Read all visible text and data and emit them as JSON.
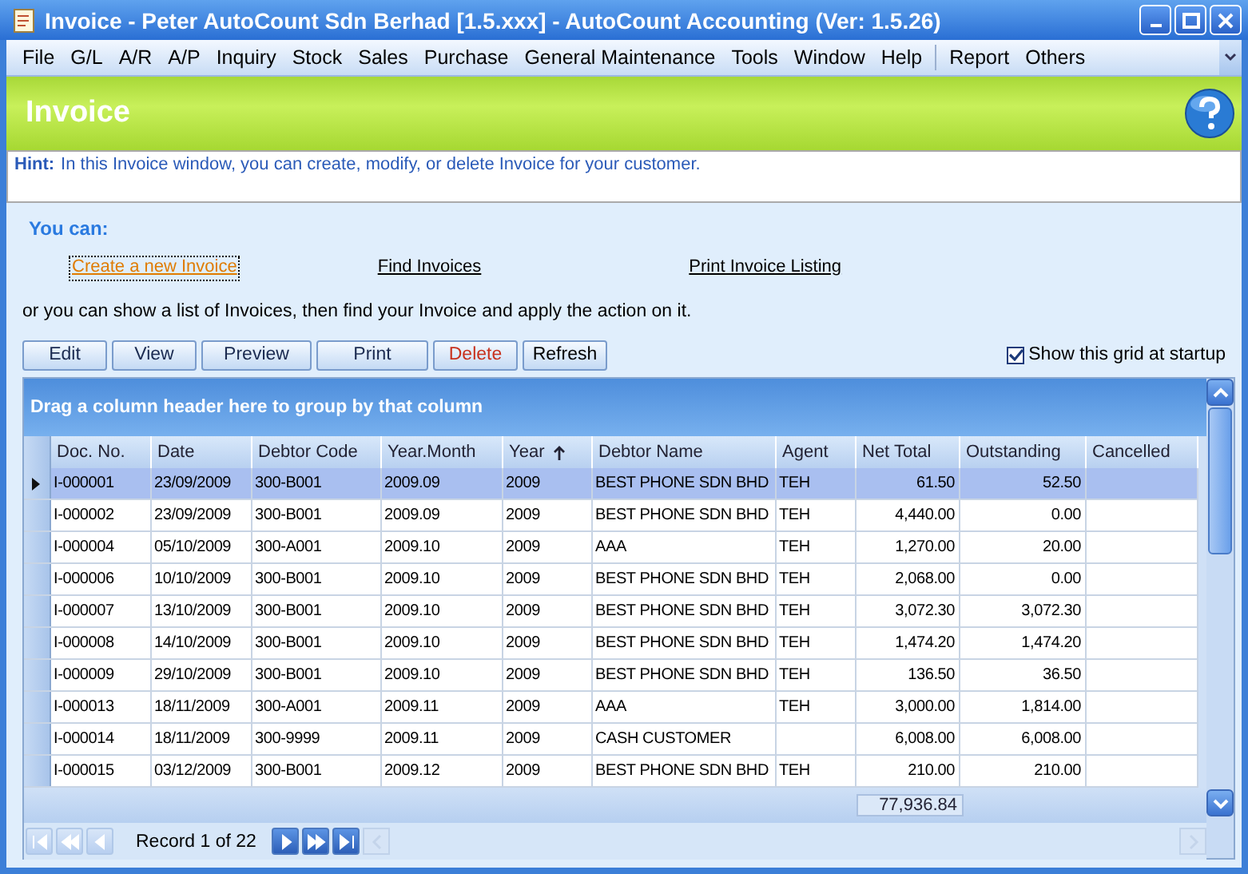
{
  "window": {
    "title": "Invoice - Peter AutoCount Sdn Berhad [1.5.xxx] - AutoCount Accounting (Ver: 1.5.26)"
  },
  "menu": {
    "items": [
      "File",
      "G/L",
      "A/R",
      "A/P",
      "Inquiry",
      "Stock",
      "Sales",
      "Purchase",
      "General Maintenance",
      "Tools",
      "Window",
      "Help"
    ],
    "extra_items": [
      "Report",
      "Others"
    ]
  },
  "header": {
    "title": "Invoice"
  },
  "hint": {
    "label": "Hint:",
    "text": "In this Invoice window, you can create, modify, or delete Invoice for your customer."
  },
  "you_can": "You can:",
  "links": [
    {
      "label": "Create a new Invoice",
      "focused": true
    },
    {
      "label": "Find Invoices",
      "focused": false
    },
    {
      "label": "Print Invoice Listing",
      "focused": false
    }
  ],
  "instruction": "or you can show a list of Invoices, then find your Invoice and apply the action on it.",
  "buttons": [
    {
      "label": "Edit",
      "kind": "normal"
    },
    {
      "label": "View",
      "kind": "normal"
    },
    {
      "label": "Preview",
      "kind": "normal"
    },
    {
      "label": "Print",
      "kind": "normal"
    },
    {
      "label": "Delete",
      "kind": "delete"
    },
    {
      "label": "Refresh",
      "kind": "normal"
    }
  ],
  "show_grid": {
    "label": "Show this grid at startup",
    "checked": true
  },
  "grid": {
    "group_panel": "Drag a column header here to group by that column",
    "columns": [
      {
        "label": "Doc. No.",
        "sorted_ascending": false
      },
      {
        "label": "Date",
        "sorted_ascending": false
      },
      {
        "label": "Debtor Code",
        "sorted_ascending": false
      },
      {
        "label": "Year.Month",
        "sorted_ascending": false
      },
      {
        "label": "Year",
        "sorted_ascending": true
      },
      {
        "label": "Debtor Name",
        "sorted_ascending": false
      },
      {
        "label": "Agent",
        "sorted_ascending": false
      },
      {
        "label": "Net Total",
        "sorted_ascending": false
      },
      {
        "label": "Outstanding",
        "sorted_ascending": false
      },
      {
        "label": "Cancelled",
        "sorted_ascending": false
      }
    ],
    "rows": [
      {
        "selected": true,
        "cells": [
          "I-000001",
          "23/09/2009",
          "300-B001",
          "2009.09",
          "2009",
          "BEST PHONE SDN BHD",
          "TEH",
          "61.50",
          "52.50",
          ""
        ]
      },
      {
        "selected": false,
        "cells": [
          "I-000002",
          "23/09/2009",
          "300-B001",
          "2009.09",
          "2009",
          "BEST PHONE SDN BHD",
          "TEH",
          "4,440.00",
          "0.00",
          ""
        ]
      },
      {
        "selected": false,
        "cells": [
          "I-000004",
          "05/10/2009",
          "300-A001",
          "2009.10",
          "2009",
          "AAA",
          "TEH",
          "1,270.00",
          "20.00",
          ""
        ]
      },
      {
        "selected": false,
        "cells": [
          "I-000006",
          "10/10/2009",
          "300-B001",
          "2009.10",
          "2009",
          "BEST PHONE SDN BHD",
          "TEH",
          "2,068.00",
          "0.00",
          ""
        ]
      },
      {
        "selected": false,
        "cells": [
          "I-000007",
          "13/10/2009",
          "300-B001",
          "2009.10",
          "2009",
          "BEST PHONE SDN BHD",
          "TEH",
          "3,072.30",
          "3,072.30",
          ""
        ]
      },
      {
        "selected": false,
        "cells": [
          "I-000008",
          "14/10/2009",
          "300-B001",
          "2009.10",
          "2009",
          "BEST PHONE SDN BHD",
          "TEH",
          "1,474.20",
          "1,474.20",
          ""
        ]
      },
      {
        "selected": false,
        "cells": [
          "I-000009",
          "29/10/2009",
          "300-B001",
          "2009.10",
          "2009",
          "BEST PHONE SDN BHD",
          "TEH",
          "136.50",
          "36.50",
          ""
        ]
      },
      {
        "selected": false,
        "cells": [
          "I-000013",
          "18/11/2009",
          "300-A001",
          "2009.11",
          "2009",
          "AAA",
          "TEH",
          "3,000.00",
          "1,814.00",
          ""
        ]
      },
      {
        "selected": false,
        "cells": [
          "I-000014",
          "18/11/2009",
          "300-9999",
          "2009.11",
          "2009",
          "CASH CUSTOMER",
          "",
          "6,008.00",
          "6,008.00",
          ""
        ]
      },
      {
        "selected": false,
        "cells": [
          "I-000015",
          "03/12/2009",
          "300-B001",
          "2009.12",
          "2009",
          "BEST PHONE SDN BHD",
          "TEH",
          "210.00",
          "210.00",
          ""
        ]
      }
    ],
    "footer_total": "77,936.84",
    "record": "Record 1 of 22",
    "nav_buttons": [
      {
        "kind": "first",
        "disabled": true
      },
      {
        "kind": "prev_page",
        "disabled": true
      },
      {
        "kind": "prev",
        "disabled": true
      },
      {
        "kind": "next",
        "disabled": false
      },
      {
        "kind": "next_page",
        "disabled": false
      },
      {
        "kind": "last",
        "disabled": false
      }
    ]
  }
}
